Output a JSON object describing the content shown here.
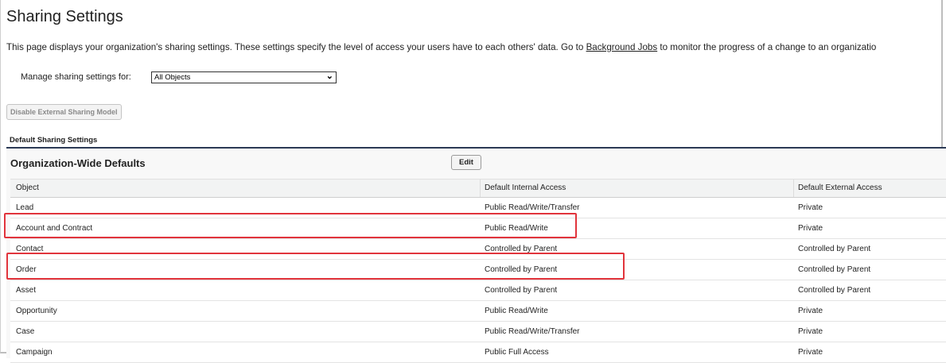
{
  "page": {
    "title": "Sharing Settings",
    "description_before_link": "This page displays your organization's sharing settings. These settings specify the level of access your users have to each others' data. Go to ",
    "description_link": "Background Jobs",
    "description_after_link": " to monitor the progress of a change to an organizatio"
  },
  "manage": {
    "label": "Manage sharing settings for:",
    "selected": "All Objects"
  },
  "buttons": {
    "disable_external": "Disable External Sharing Model",
    "edit": "Edit"
  },
  "section": {
    "label": "Default Sharing Settings",
    "panel_title": "Organization-Wide Defaults"
  },
  "table": {
    "headers": [
      "Object",
      "Default Internal Access",
      "Default External Access"
    ],
    "rows": [
      [
        "Lead",
        "Public Read/Write/Transfer",
        "Private"
      ],
      [
        "Account and Contract",
        "Public Read/Write",
        "Private"
      ],
      [
        "Contact",
        "Controlled by Parent",
        "Controlled by Parent"
      ],
      [
        "Order",
        "Controlled by Parent",
        "Controlled by Parent"
      ],
      [
        "Asset",
        "Controlled by Parent",
        "Controlled by Parent"
      ],
      [
        "Opportunity",
        "Public Read/Write",
        "Private"
      ],
      [
        "Case",
        "Public Read/Write/Transfer",
        "Private"
      ],
      [
        "Campaign",
        "Public Full Access",
        "Private"
      ]
    ]
  },
  "colors": {
    "highlight": "#e1343c",
    "panel_border": "#2b3a55"
  },
  "icons": {
    "select": "chevron-down-icon"
  }
}
